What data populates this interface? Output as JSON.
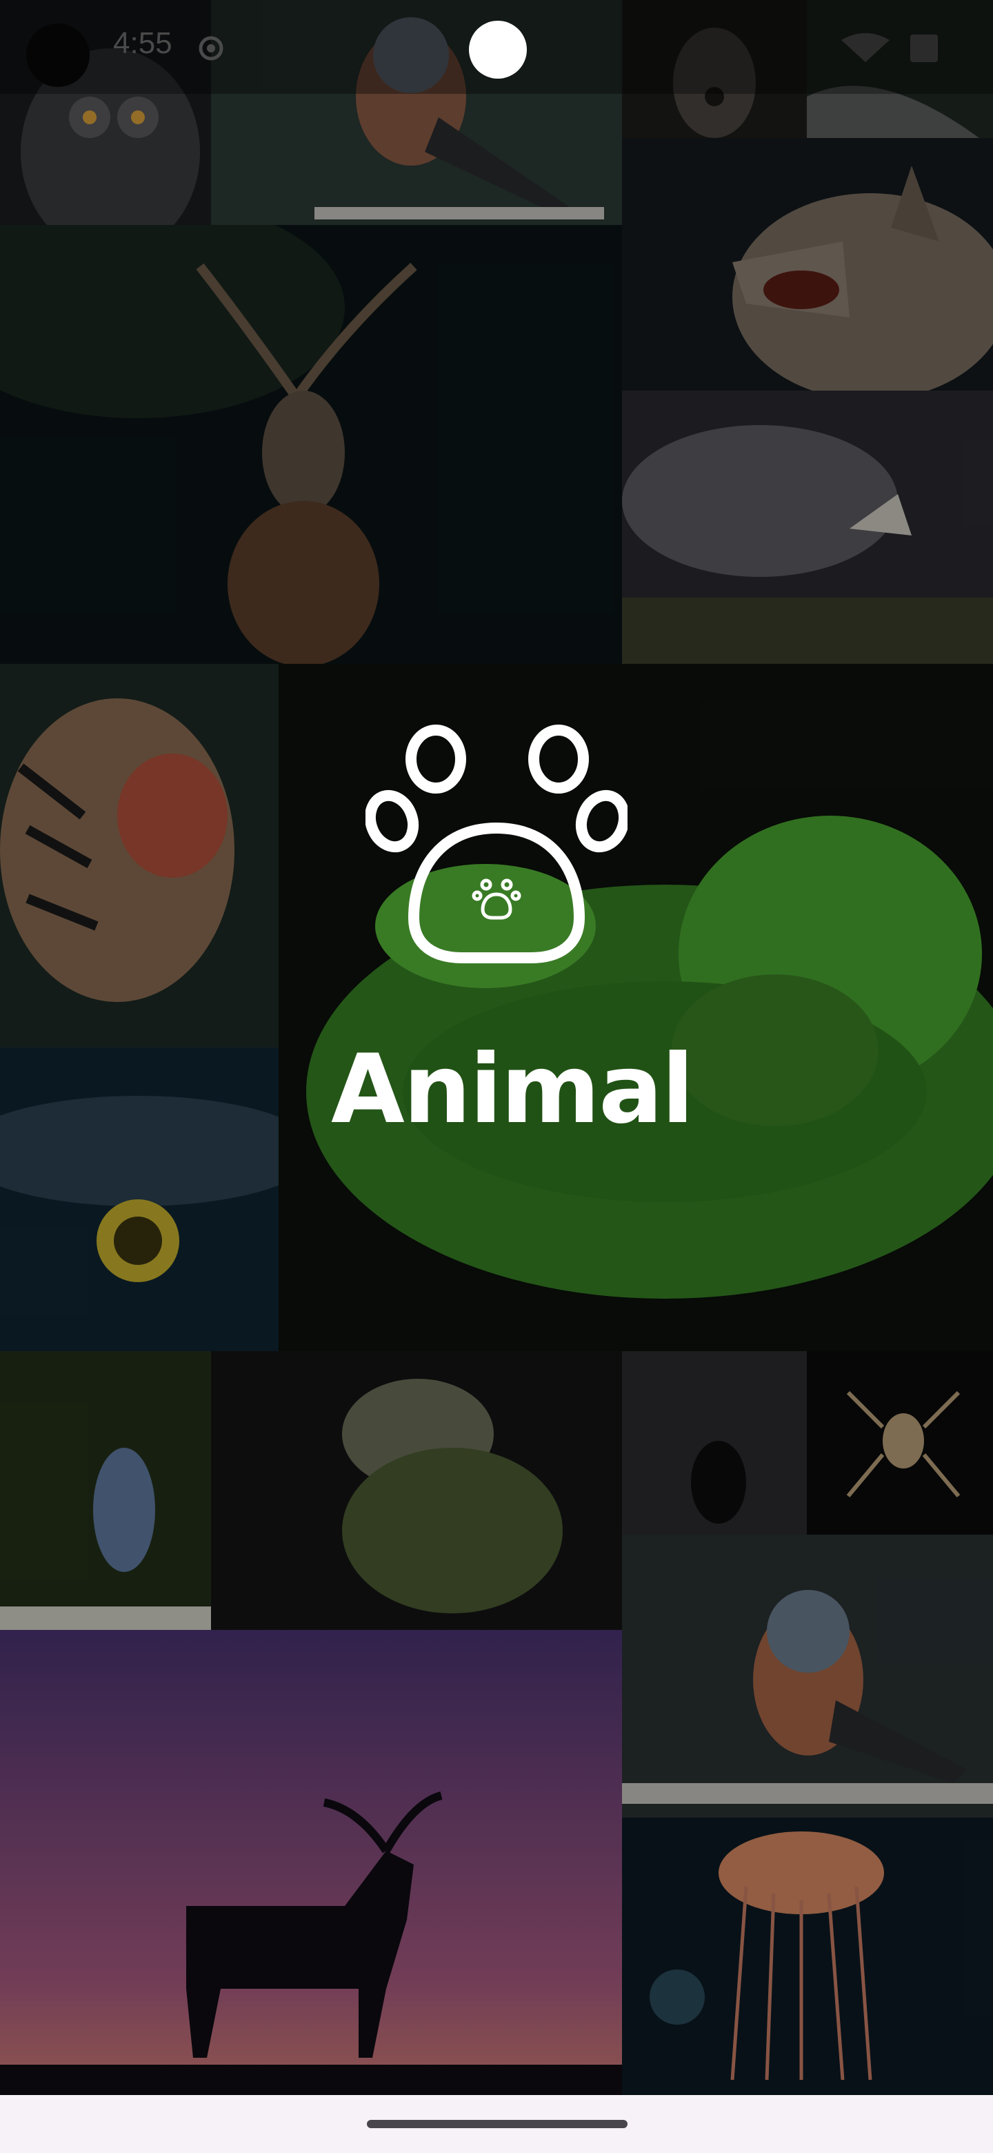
{
  "status_bar": {
    "time": "4:55",
    "icons": [
      "settings-icon",
      "wifi-icon",
      "battery-icon"
    ]
  },
  "splash": {
    "app_name": "Animal",
    "logo_icon": "paw-icon"
  },
  "gallery": {
    "tiles": [
      "owl-photo",
      "chaffinch-photo",
      "deer-photo-top",
      "wood-photo",
      "stag-photo",
      "wolf-photo",
      "rhino-photo",
      "tiger-photo",
      "green-python-photo",
      "snail-photo",
      "heron-photo",
      "iguana-photo",
      "crow-photo",
      "spider-photo",
      "chaffinch-photo-2",
      "deer-silhouette-photo",
      "jellyfish-photo"
    ]
  },
  "colors": {
    "accent_green": "#3f8f2a",
    "overlay": "#000000",
    "nav_bar": "#f6f2f7"
  }
}
